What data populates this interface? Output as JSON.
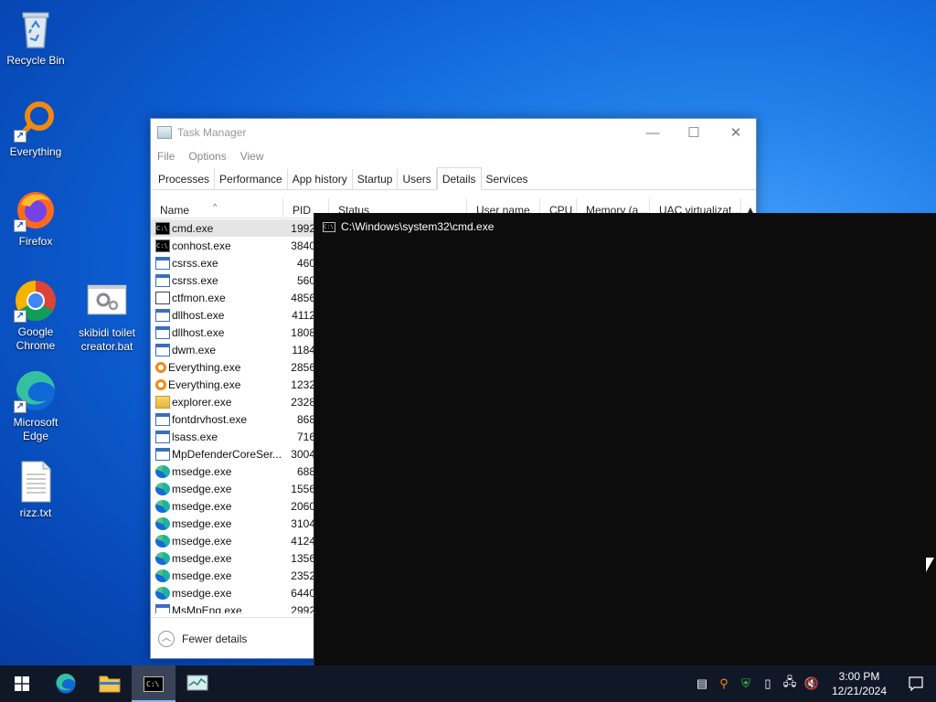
{
  "desktop": {
    "icons": [
      {
        "label": "Recycle Bin"
      },
      {
        "label": "Everything"
      },
      {
        "label": "Firefox"
      },
      {
        "label": "Google Chrome"
      },
      {
        "label": "skibidi toilet creator.bat"
      },
      {
        "label": "Microsoft Edge"
      },
      {
        "label": "rizz.txt"
      }
    ]
  },
  "task_manager": {
    "title": "Task Manager",
    "menu": [
      "File",
      "Options",
      "View"
    ],
    "tabs": [
      "Processes",
      "Performance",
      "App history",
      "Startup",
      "Users",
      "Details",
      "Services"
    ],
    "active_tab": "Details",
    "columns": [
      "Name",
      "PID",
      "Status",
      "User name",
      "CPU",
      "Memory (a...",
      "UAC virtualizat..."
    ],
    "rows": [
      {
        "name": "cmd.exe",
        "pid": "1992",
        "icon": "cmd-icon"
      },
      {
        "name": "conhost.exe",
        "pid": "3840",
        "icon": "cmd-icon"
      },
      {
        "name": "csrss.exe",
        "pid": "460",
        "icon": "window-icon"
      },
      {
        "name": "csrss.exe",
        "pid": "560",
        "icon": "window-icon"
      },
      {
        "name": "ctfmon.exe",
        "pid": "4856",
        "icon": "pen-icon"
      },
      {
        "name": "dllhost.exe",
        "pid": "4112",
        "icon": "window-icon"
      },
      {
        "name": "dllhost.exe",
        "pid": "1808",
        "icon": "window-icon"
      },
      {
        "name": "dwm.exe",
        "pid": "1184",
        "icon": "window-icon"
      },
      {
        "name": "Everything.exe",
        "pid": "2856",
        "icon": "magnifier-icon"
      },
      {
        "name": "Everything.exe",
        "pid": "1232",
        "icon": "magnifier-icon"
      },
      {
        "name": "explorer.exe",
        "pid": "2328",
        "icon": "folder-icon"
      },
      {
        "name": "fontdrvhost.exe",
        "pid": "868",
        "icon": "window-icon"
      },
      {
        "name": "lsass.exe",
        "pid": "716",
        "icon": "window-icon"
      },
      {
        "name": "MpDefenderCoreSer...",
        "pid": "3004",
        "icon": "window-icon"
      },
      {
        "name": "msedge.exe",
        "pid": "688",
        "icon": "edge-icon"
      },
      {
        "name": "msedge.exe",
        "pid": "1556",
        "icon": "edge-icon"
      },
      {
        "name": "msedge.exe",
        "pid": "2060",
        "icon": "edge-icon"
      },
      {
        "name": "msedge.exe",
        "pid": "3104",
        "icon": "edge-icon"
      },
      {
        "name": "msedge.exe",
        "pid": "4124",
        "icon": "edge-icon"
      },
      {
        "name": "msedge.exe",
        "pid": "1356",
        "icon": "edge-icon"
      },
      {
        "name": "msedge.exe",
        "pid": "2352",
        "icon": "edge-icon"
      },
      {
        "name": "msedge.exe",
        "pid": "6440",
        "icon": "edge-icon"
      },
      {
        "name": "MsMpEng.exe",
        "pid": "2992",
        "icon": "window-icon"
      }
    ],
    "fewer_details": "Fewer details"
  },
  "cmd": {
    "title": "C:\\Windows\\system32\\cmd.exe"
  },
  "taskbar": {
    "time": "3:00 PM",
    "date": "12/21/2024"
  }
}
